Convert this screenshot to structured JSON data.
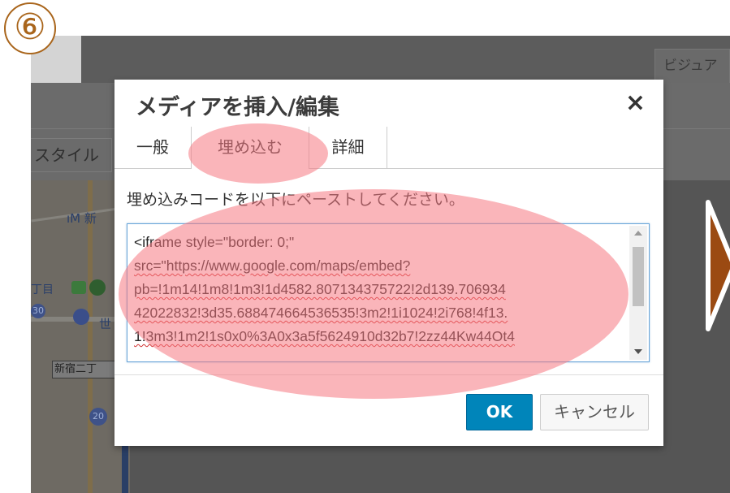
{
  "step": "⑥",
  "background": {
    "visual_tab_label": "ビジュア",
    "style_button_label": "スタイル",
    "map": {
      "label_shinjuku": "ıM 新",
      "label_chome": "丁目",
      "label_station": "新宿二丁",
      "label_world": "世",
      "pin_30": "30",
      "pin_20": "20"
    }
  },
  "modal": {
    "title": "メディアを挿入/編集",
    "close_label": "×",
    "tabs": [
      {
        "label": "一般"
      },
      {
        "label": "埋め込む"
      },
      {
        "label": "詳細"
      }
    ],
    "instruction": "埋め込みコードを以下にペーストしてください。",
    "code_lines": [
      "<iframe style=\"border: 0;\"",
      "src=\"https://www.google.com/maps/embed?",
      "pb=!1m14!1m8!1m3!1d4582.807134375722!2d139.706934",
      "42022832!3d35.688474664536535!3m2!1i1024!2i768!4f13.",
      "1!3m3!1m2!1s0x0%3A0x3a5f5624910d32b7!2zz44Kw44Ot4"
    ],
    "ok_label": "OK",
    "cancel_label": "キャンセル"
  },
  "colors": {
    "badge": "#a9651b",
    "ok_button": "#0085ba",
    "highlight": "#f57882",
    "arrow": "#9b4a12"
  },
  "icons": {
    "close": "close-icon",
    "next": "next-arrow-icon"
  }
}
